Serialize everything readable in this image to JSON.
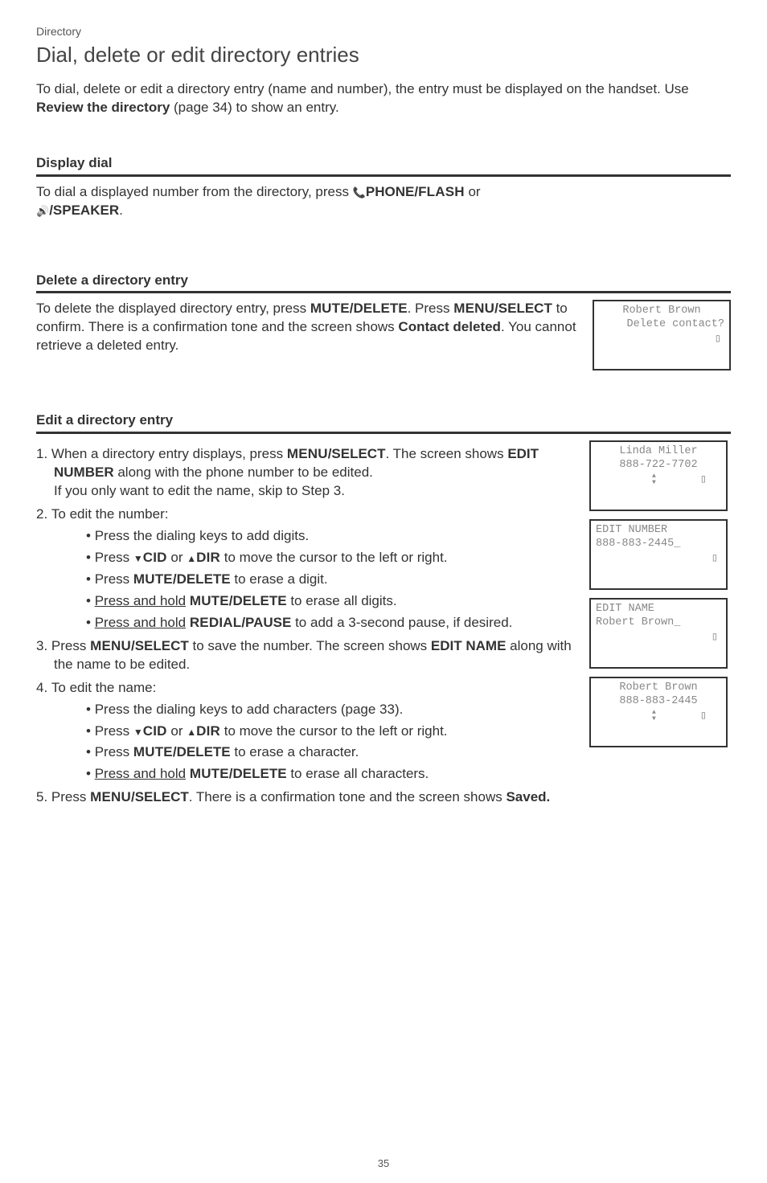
{
  "crumb": "Directory",
  "title": "Dial, delete or edit directory entries",
  "intro_parts": [
    "To dial, delete or edit a directory entry (name and number), the entry must be displayed on the handset. Use ",
    "Review the directory",
    " (page 34) to show an entry."
  ],
  "display_dial": {
    "heading": "Display dial",
    "parts": [
      "To dial a displayed number from the directory, press ",
      "PHONE/",
      "FLASH",
      " or ",
      "/SPEAKER",
      "."
    ]
  },
  "delete_entry": {
    "heading": "Delete a directory entry",
    "parts": [
      "To delete the displayed directory entry, press ",
      "MUTE",
      "/DELETE",
      ". Press ",
      "MENU",
      "/SELECT",
      " to confirm. There is a confirmation tone and the screen shows ",
      "Contact deleted",
      ". You cannot retrieve a deleted entry."
    ],
    "lcd": {
      "line1": "Robert Brown",
      "line2": "Delete contact?"
    }
  },
  "edit_entry": {
    "heading": "Edit a directory entry",
    "step1": {
      "prefix": "1.",
      "parts_a": [
        "When a directory entry displays, press ",
        "MENU",
        "/SELECT",
        ". The screen shows "
      ],
      "bold": "EDIT NUMBER",
      "parts_b": " along with the phone number to be edited.",
      "parts_c": "If you only want to edit the name, skip to Step 3."
    },
    "step2": {
      "prefix": "2.",
      "text": "To edit the number:",
      "bullets": [
        {
          "plain": "Press the dialing keys to add digits."
        },
        {
          "parts": [
            "Press ",
            "CID",
            " or ",
            "DIR",
            " to move the cursor to the left or right."
          ]
        },
        {
          "parts": [
            "Press ",
            "MUTE",
            "/DELETE",
            " to erase a digit."
          ]
        },
        {
          "parts_u": [
            "Press and hold",
            " ",
            "MUTE",
            "/DELETE",
            " to erase all digits."
          ]
        },
        {
          "parts_u2": [
            "Press and hold",
            " ",
            "REDIAL",
            "/PAUSE",
            " to add a 3-second pause, if desired."
          ]
        }
      ]
    },
    "step3": {
      "prefix": "3.",
      "parts": [
        "Press ",
        "MENU",
        "/SELECT",
        " to save the number. The screen shows "
      ],
      "bold": "EDIT NAME",
      "suffix": " along with the name to be edited."
    },
    "step4": {
      "prefix": "4.",
      "text": "To edit the name:",
      "bullets": [
        {
          "plain": "Press the dialing keys to add characters (page 33)."
        },
        {
          "parts": [
            "Press ",
            "CID",
            " or ",
            "DIR",
            " to move the cursor to the left or right."
          ]
        },
        {
          "parts": [
            "Press ",
            "MUTE",
            "/DELETE",
            " to erase a character."
          ]
        },
        {
          "parts_u": [
            "Press and hold",
            " ",
            "MUTE",
            "/DELETE",
            " to erase all characters."
          ]
        }
      ]
    },
    "step5": {
      "prefix": "5.",
      "parts": [
        "Press ",
        "MENU",
        "/SELECT",
        ". There is a confirmation tone and the screen shows ",
        "Saved."
      ]
    },
    "lcds": [
      {
        "line1": "Linda Miller",
        "line2": "888-722-7702",
        "nav": true
      },
      {
        "line1_left": "EDIT NUMBER",
        "line2_left": "888-883-2445_",
        "nav": false
      },
      {
        "line1_left": "EDIT NAME",
        "line2_left": "Robert Brown_",
        "nav": false
      },
      {
        "line1": "Robert Brown",
        "line2": "888-883-2445",
        "nav": true
      }
    ]
  },
  "page_number": "35"
}
